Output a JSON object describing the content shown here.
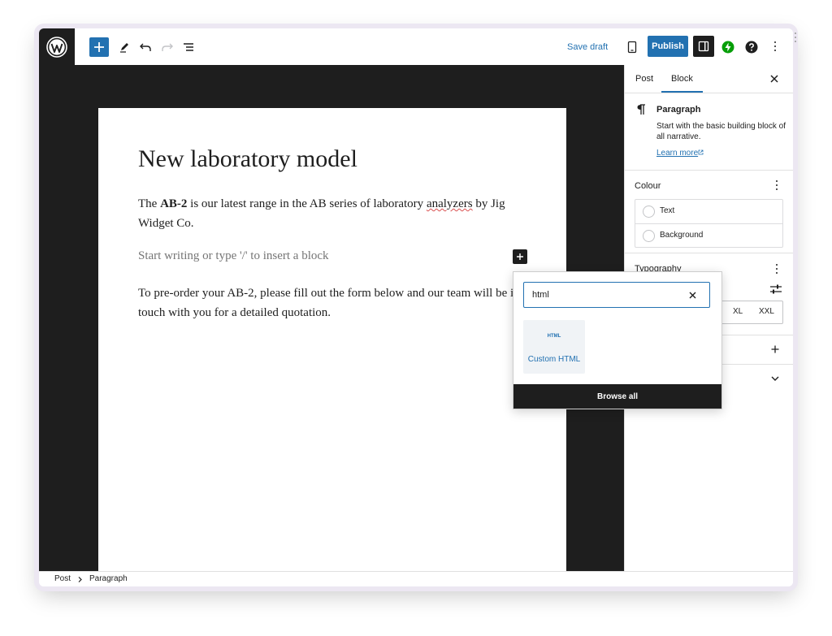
{
  "topbar": {
    "logo_icon": "wordpress-logo-icon",
    "add_block_icon": "plus-icon",
    "tools_icon": "pencil-icon",
    "undo_icon": "undo-icon",
    "redo_icon": "redo-icon",
    "outline_icon": "list-view-icon",
    "save_draft": "Save draft",
    "preview_icon": "tablet-icon",
    "publish": "Publish",
    "settings_icon": "sidebar-toggle-icon",
    "plugin_icon": "jetpack-bolt-icon",
    "help_icon": "help-icon",
    "options_icon": "more-vertical-icon"
  },
  "editor": {
    "title": "New laboratory model",
    "paragraph1": {
      "prefix": "The ",
      "bold": "AB-2",
      "middle": " is our latest range in the AB series of laboratory ",
      "misspelled": "analyzers",
      "suffix": " by Jig Widget Co."
    },
    "placeholder": "Start writing or type '/' to insert a block",
    "paragraph2": "To pre-order your AB-2, please fill out the form below and our team will be in touch with you for a detailed quotation."
  },
  "inserter": {
    "search_value": "html",
    "result_icon_text": "HTML",
    "result_label": "Custom HTML",
    "browse_all": "Browse all"
  },
  "sidebar": {
    "tabs": [
      {
        "label": "Post",
        "active": false
      },
      {
        "label": "Block",
        "active": true
      }
    ],
    "block_icon": "pilcrow-icon",
    "block_name": "Paragraph",
    "block_description": "Start with the basic building block of all narrative.",
    "learn_more": "Learn more",
    "colour_heading": "Colour",
    "colour_options": [
      "Text",
      "Background"
    ],
    "typography_heading": "Typography",
    "size_options": [
      "XL",
      "XXL"
    ]
  },
  "footer": {
    "breadcrumbs": [
      "Post",
      "Paragraph"
    ]
  },
  "colors": {
    "accent": "#2271b1",
    "dark": "#1e1e1e",
    "canvas": "#1e1e1e"
  }
}
